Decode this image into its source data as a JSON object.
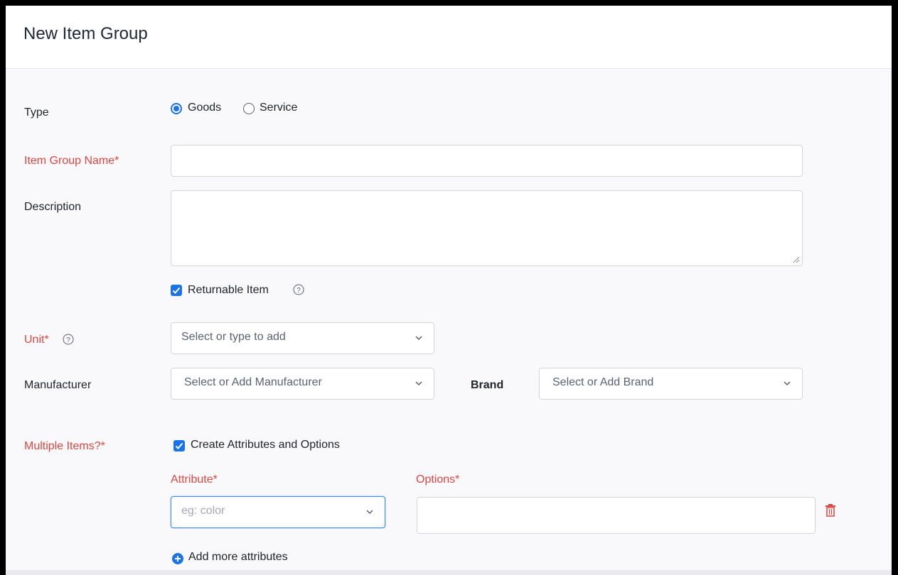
{
  "header": {
    "title": "New Item Group"
  },
  "form": {
    "type": {
      "label": "Type",
      "options": [
        "Goods",
        "Service"
      ],
      "selected": "Goods"
    },
    "item_group_name": {
      "label": "Item Group Name*",
      "value": ""
    },
    "description": {
      "label": "Description",
      "value": ""
    },
    "returnable": {
      "label": "Returnable Item",
      "checked": true
    },
    "unit": {
      "label": "Unit*",
      "placeholder": "Select or type to add"
    },
    "manufacturer": {
      "label": "Manufacturer",
      "placeholder": "Select or Add Manufacturer"
    },
    "brand": {
      "label": "Brand",
      "placeholder": "Select or Add Brand"
    },
    "multiple_items": {
      "label": "Multiple Items?*",
      "checkbox_label": "Create Attributes and Options",
      "checked": true
    },
    "attribute": {
      "label": "Attribute*",
      "placeholder": "eg: color"
    },
    "options": {
      "label": "Options*",
      "value": ""
    },
    "add_more": {
      "label": "Add more attributes"
    }
  },
  "colors": {
    "required": "#e0463f",
    "accent": "#1a73e8",
    "focus": "#408dfb",
    "delete": "#e0463f"
  },
  "icons": [
    "help-icon",
    "chevron-down-icon",
    "trash-icon",
    "plus-circle-icon",
    "check-icon",
    "resize-grip-icon"
  ]
}
